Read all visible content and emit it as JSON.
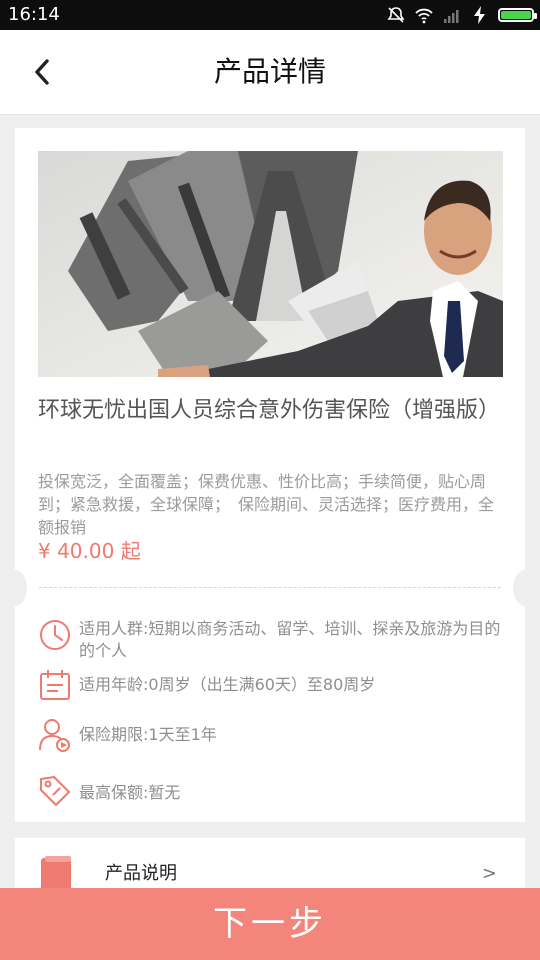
{
  "status_bar": {
    "time": "16:14",
    "icons": [
      "mute-icon",
      "wifi-icon",
      "signal-icon",
      "charging-icon",
      "battery-icon"
    ],
    "battery_level": 1.0
  },
  "header": {
    "back_icon": "chevron-left-icon",
    "title": "产品详情"
  },
  "product": {
    "image_icon": "hero-image",
    "title": "环球无忧出国人员综合意外伤害保险（增强版）",
    "description": "投保宽泛，全面覆盖；保费优惠、性价比高；手续简便，贴心周到；紧急救援，全球保障；　保险期间、灵活选择；医疗费用，全额报销",
    "price": "¥ 40.00 起",
    "details": [
      {
        "icon": "clock-icon",
        "text": "适用人群:短期以商务活动、留学、培训、探亲及旅游为目的的个人"
      },
      {
        "icon": "calendar-icon",
        "text": "适用年龄:0周岁（出生满60天）至80周岁"
      },
      {
        "icon": "person-play-icon",
        "text": "保险期限:1天至1年"
      },
      {
        "icon": "tag-icon",
        "text": "最高保额:暂无"
      }
    ]
  },
  "sections": [
    {
      "icon": "book-icon",
      "label": "产品说明",
      "chevron": ">"
    }
  ],
  "footer": {
    "next_label": "下一步"
  },
  "colors": {
    "accent": "#ef7a70",
    "button": "#f3857b",
    "status_bar": "#0d0d0d",
    "background": "#efefef"
  }
}
